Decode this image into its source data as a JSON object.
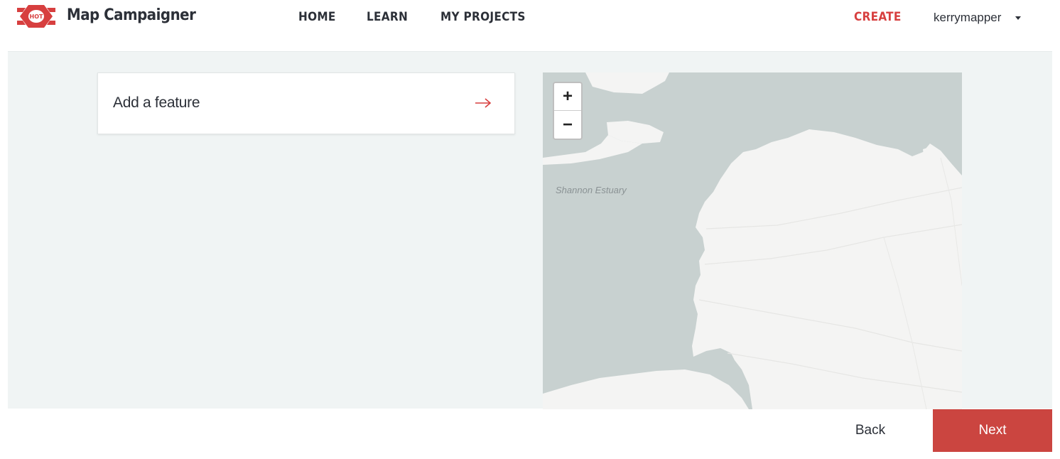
{
  "header": {
    "logo_text": "HOT",
    "app_title": "Map Campaigner",
    "nav": {
      "home": "HOME",
      "learn": "LEARN",
      "my_projects": "MY PROJECTS",
      "create": "CREATE"
    },
    "username": "kerrymapper",
    "accent_color": "#d73f3f"
  },
  "main": {
    "feature_card": {
      "title": "Add a feature",
      "icon": "arrow-right-icon"
    },
    "map": {
      "place_label": "Shannon Estuary",
      "zoom_in_label": "+",
      "zoom_out_label": "−",
      "water_color": "#c8d1d0",
      "land_color": "#f4f4f3"
    }
  },
  "footer": {
    "back_label": "Back",
    "next_label": "Next",
    "next_color": "#cb4540"
  }
}
